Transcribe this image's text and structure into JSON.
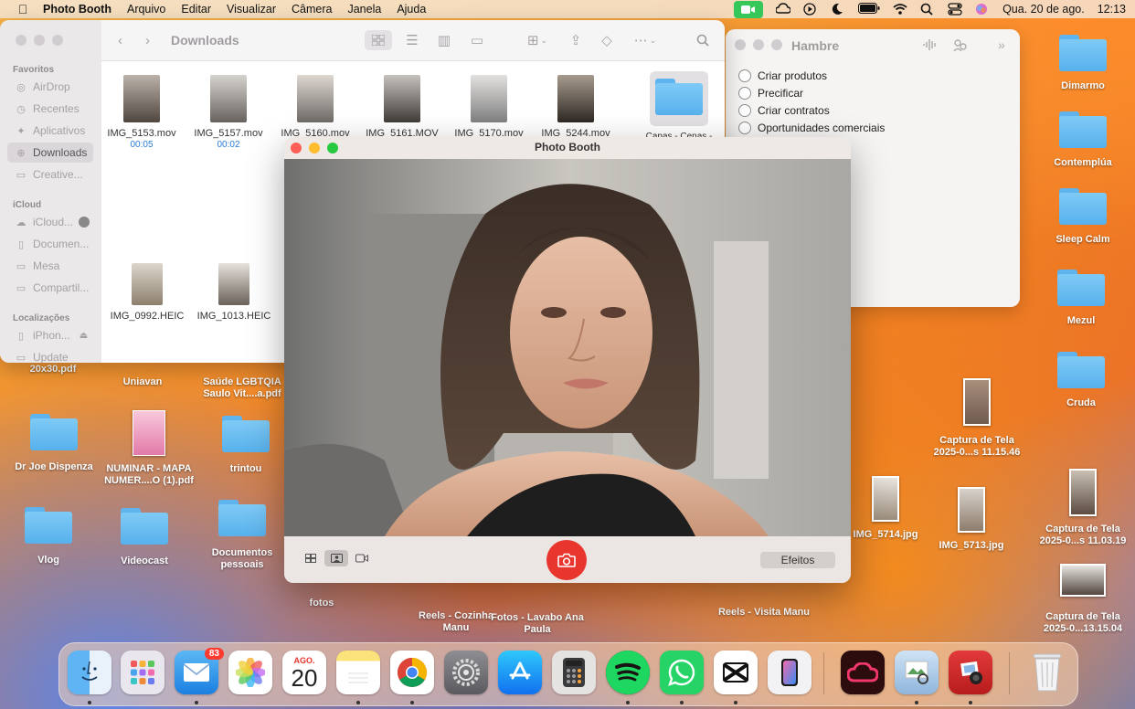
{
  "menubar": {
    "app_name": "Photo Booth",
    "menus": [
      "Arquivo",
      "Editar",
      "Visualizar",
      "Câmera",
      "Janela",
      "Ajuda"
    ],
    "datetime": "Qua. 20 de ago.",
    "time": "12:13"
  },
  "finder": {
    "title": "Downloads",
    "sidebar": {
      "favorites_header": "Favoritos",
      "favorites": [
        "AirDrop",
        "Recentes",
        "Aplicativos",
        "Downloads",
        "Creative..."
      ],
      "icloud_header": "iCloud",
      "icloud": [
        "iCloud...",
        "Documen...",
        "Mesa",
        "Compartil..."
      ],
      "locations_header": "Localizações",
      "locations": [
        "iPhon...",
        "Update"
      ]
    },
    "files": [
      {
        "name": "IMG_5153.mov",
        "duration": "00:05"
      },
      {
        "name": "IMG_5157.mov",
        "duration": "00:02"
      },
      {
        "name": "IMG_5160.mov",
        "duration": ""
      },
      {
        "name": "IMG_5161.MOV",
        "duration": ""
      },
      {
        "name": "IMG_5170.mov",
        "duration": ""
      },
      {
        "name": "IMG_5244.mov",
        "duration": ""
      },
      {
        "name": "Capas - Cenas - Dimarmo",
        "duration": ""
      },
      {
        "name": "IMG_0992.HEIC",
        "duration": ""
      },
      {
        "name": "IMG_1013.HEIC",
        "duration": ""
      }
    ]
  },
  "hambre": {
    "title": "Hambre",
    "items": [
      "Criar produtos",
      "Precificar",
      "Criar contratos",
      "Oportunidades comerciais"
    ]
  },
  "photobooth": {
    "title": "Photo Booth",
    "effects_label": "Efeitos"
  },
  "desktop": {
    "icons": [
      {
        "label": "Dimarmo"
      },
      {
        "label": "Contemplúa"
      },
      {
        "label": "Sleep Calm"
      },
      {
        "label": "Mezul"
      },
      {
        "label": "Cruda"
      },
      {
        "label": "20x30.pdf"
      },
      {
        "label": "Uniavan"
      },
      {
        "label": "Saúde LGBTQIA Saulo Vit....a.pdf"
      },
      {
        "label": "Dr Joe Dispenza"
      },
      {
        "label": "NUMINAR - MAPA NUMER....O (1).pdf"
      },
      {
        "label": "trintou"
      },
      {
        "label": "Vlog"
      },
      {
        "label": "Videocast"
      },
      {
        "label": "Documentos pessoais"
      },
      {
        "label": "fotos"
      },
      {
        "label": "Reels - Cozinha Manu"
      },
      {
        "label": "Fotos - Lavabo Ana Paula"
      },
      {
        "label": "Reels - Visita Manu"
      },
      {
        "label": "Captura de Tela 2025-0...s 11.15.46"
      },
      {
        "label": "IMG_5714.jpg"
      },
      {
        "label": "IMG_5713.jpg"
      },
      {
        "label": "Captura de Tela 2025-0...s 11.03.19"
      },
      {
        "label": "Captura de Tela 2025-0...13.15.04"
      }
    ]
  },
  "dock": {
    "mail_badge": "83",
    "calendar_month": "AGO.",
    "calendar_day": "20"
  }
}
